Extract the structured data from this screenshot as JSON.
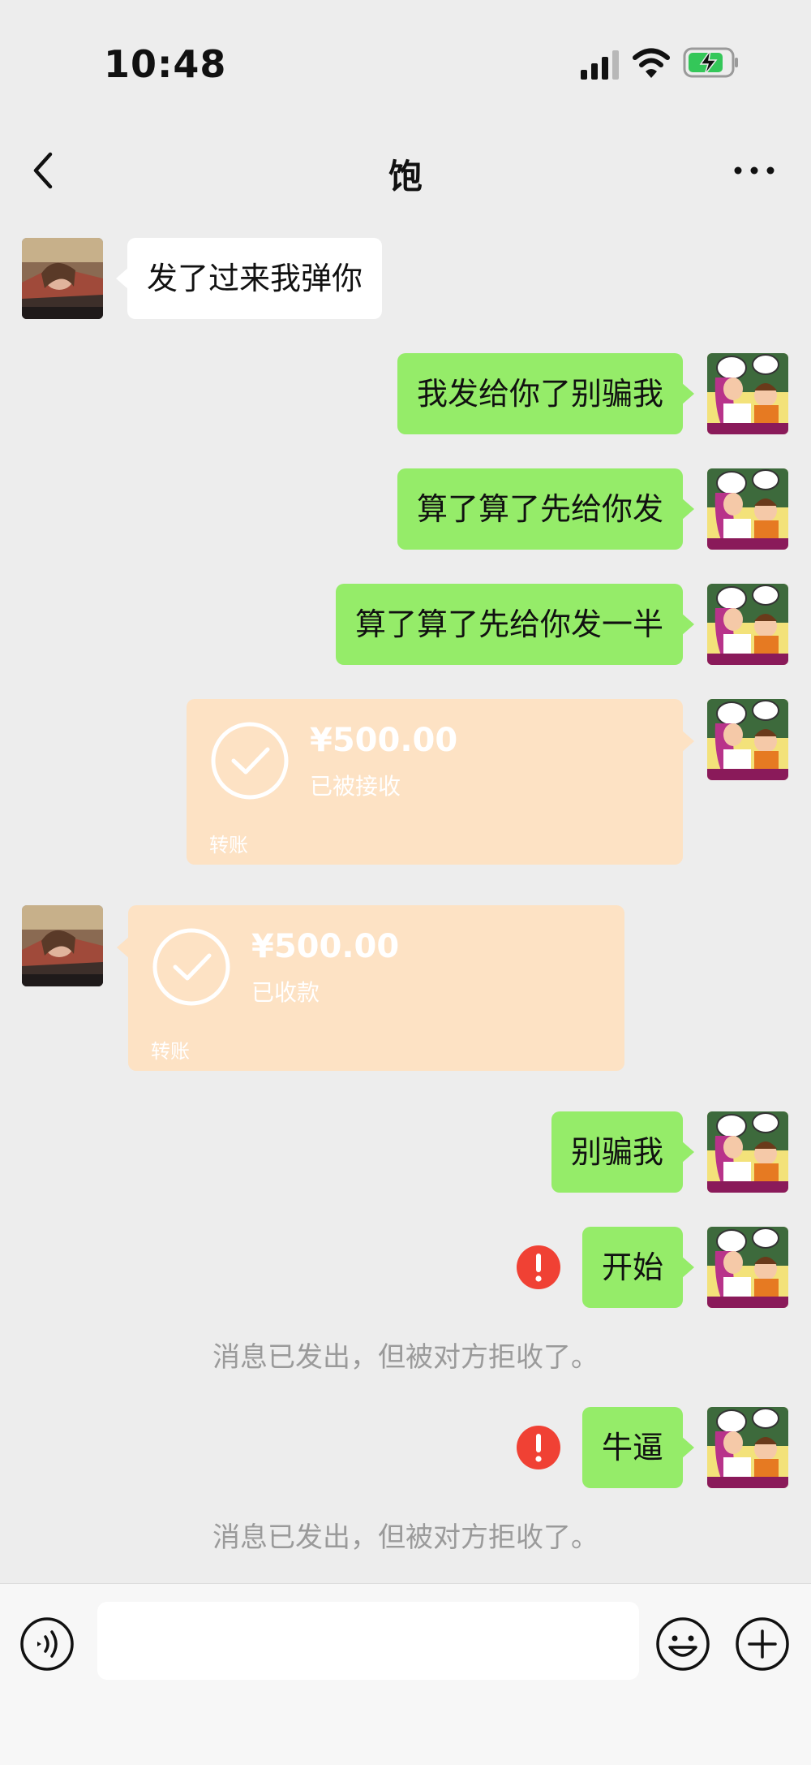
{
  "status_bar": {
    "time": "10:48",
    "icons": [
      "signal-icon",
      "wifi-icon",
      "battery-charging-icon"
    ]
  },
  "header": {
    "title": "饱",
    "back_icon": "chevron-left-icon",
    "more_icon": "more-dots-icon"
  },
  "messages": [
    {
      "side": "left",
      "type": "text",
      "text": "发了过来我弹你"
    },
    {
      "side": "right",
      "type": "text",
      "text": "我发给你了别骗我"
    },
    {
      "side": "right",
      "type": "text",
      "text": "算了算了先给你发"
    },
    {
      "side": "right",
      "type": "text",
      "text": "算了算了先给你发一半"
    },
    {
      "side": "right",
      "type": "transfer",
      "amount": "¥500.00",
      "status": "已被接收",
      "label": "转账"
    },
    {
      "side": "left",
      "type": "transfer",
      "amount": "¥500.00",
      "status": "已收款",
      "label": "转账"
    },
    {
      "side": "right",
      "type": "text",
      "text": "别骗我"
    },
    {
      "side": "right",
      "type": "text",
      "text": "开始",
      "error": true
    },
    {
      "type": "system",
      "text": "消息已发出，但被对方拒收了。"
    },
    {
      "side": "right",
      "type": "text",
      "text": "牛逼",
      "error": true
    },
    {
      "type": "system",
      "text": "消息已发出，但被对方拒收了。"
    }
  ],
  "input_bar": {
    "value": "",
    "placeholder": "",
    "icons": [
      "voice-icon",
      "emoji-icon",
      "plus-icon"
    ]
  },
  "colors": {
    "background": "#ededed",
    "sent_bubble": "#95ec69",
    "received_bubble": "#ffffff",
    "transfer_card": "#fde2c4",
    "error": "#f04134",
    "system_text": "#9a9a9a"
  }
}
